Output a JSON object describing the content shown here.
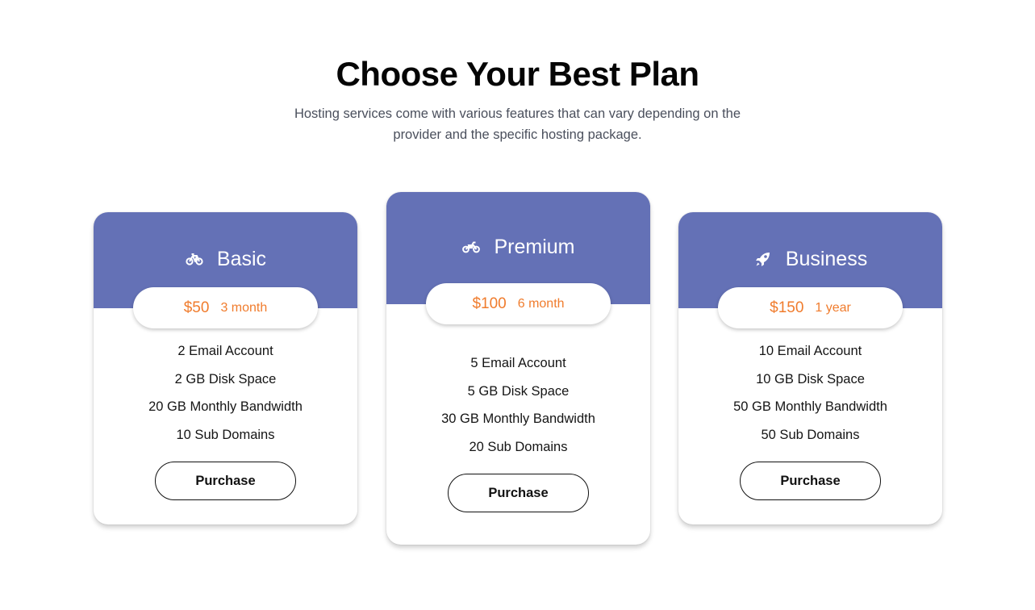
{
  "header": {
    "title": "Choose Your Best Plan",
    "subtitle": "Hosting services come with various features that can vary depending on the provider and the specific hosting package."
  },
  "colors": {
    "card_header": "#6471b6",
    "price_accent": "#f07c2d",
    "page_background": "#ffffff"
  },
  "plans": [
    {
      "name": "Basic",
      "icon": "bicycle-icon",
      "price": "$50",
      "period": "3 month",
      "features": [
        "2 Email Account",
        "2 GB Disk Space",
        "20 GB Monthly Bandwidth",
        "10 Sub Domains"
      ],
      "button_label": "Purchase"
    },
    {
      "name": "Premium",
      "icon": "motorcycle-icon",
      "price": "$100",
      "period": "6 month",
      "features": [
        "5 Email Account",
        "5 GB Disk Space",
        "30 GB Monthly Bandwidth",
        "20 Sub Domains"
      ],
      "button_label": "Purchase"
    },
    {
      "name": "Business",
      "icon": "rocket-icon",
      "price": "$150",
      "period": "1 year",
      "features": [
        "10 Email Account",
        "10 GB Disk Space",
        "50 GB Monthly Bandwidth",
        "50 Sub Domains"
      ],
      "button_label": "Purchase"
    }
  ]
}
